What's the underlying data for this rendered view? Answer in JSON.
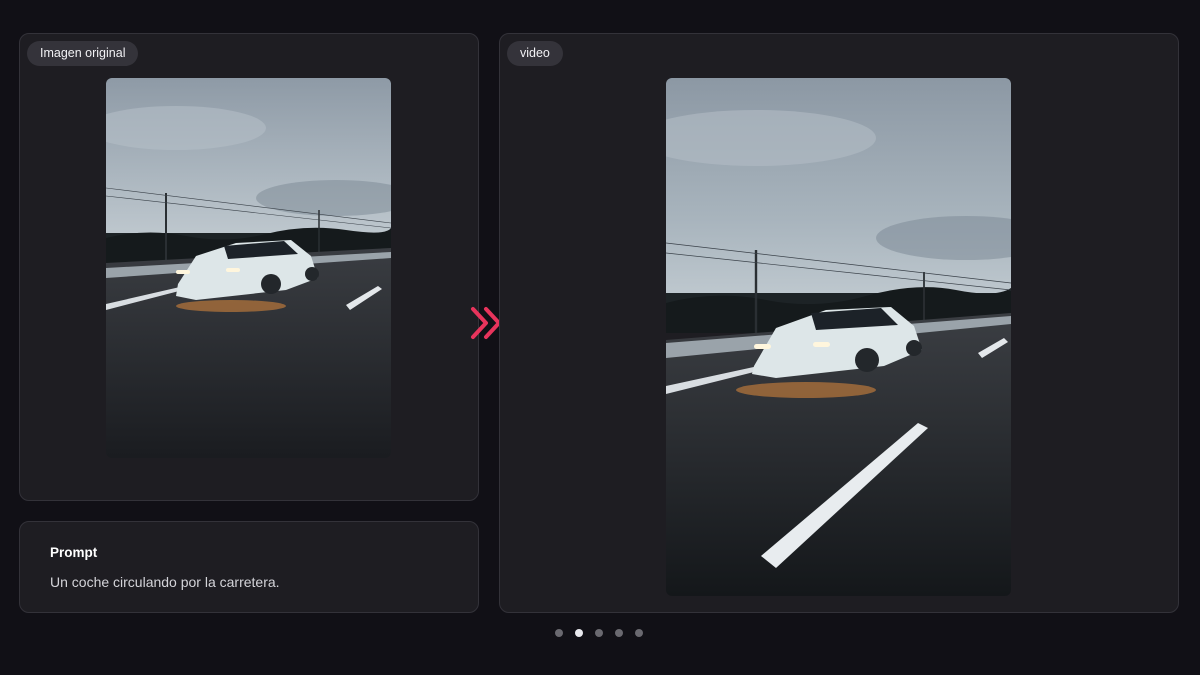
{
  "original": {
    "badge": "Imagen original",
    "image": "photo of a white sports car driving on a highway at dusk"
  },
  "video": {
    "badge": "video",
    "image": "video frame of a white sports car driving on a highway at dusk"
  },
  "prompt": {
    "title": "Prompt",
    "text": "Un coche circulando por la carretera."
  },
  "icons": {
    "transition": "double-chevron-right-icon"
  },
  "colors": {
    "accent": "#e8345c",
    "background": "#111016",
    "panel": "#1e1d22"
  },
  "pagination": {
    "total": 5,
    "active_index": 1
  }
}
